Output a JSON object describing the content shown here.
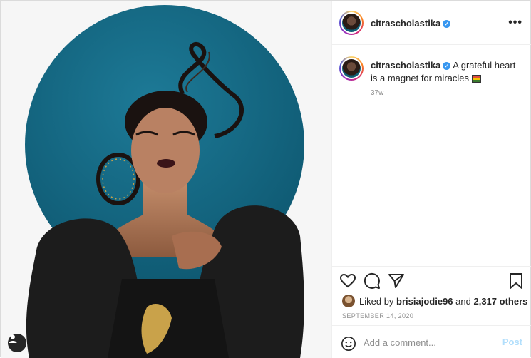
{
  "post": {
    "username": "citrascholastika",
    "verified_icon": "verified-badge-icon",
    "more_icon": "more-options-icon"
  },
  "caption": {
    "username": "citrascholastika",
    "text": "A grateful heart is a magnet for miracles",
    "flag_icon": "rainbow-flag-emoji",
    "age": "37w"
  },
  "actions": {
    "like_icon": "heart-icon",
    "comment_icon": "comment-bubble-icon",
    "share_icon": "paper-plane-icon",
    "save_icon": "bookmark-icon"
  },
  "likes": {
    "prefix": "Liked by",
    "user": "brisiajodie96",
    "and": "and",
    "count": "2,317 others"
  },
  "date": "SEPTEMBER 14, 2020",
  "comment": {
    "placeholder": "Add a comment...",
    "post_label": "Post"
  },
  "colors": {
    "accent_blue": "#3897f0",
    "post_disabled": "#b2dffc",
    "photo_circle": "#136a88"
  }
}
